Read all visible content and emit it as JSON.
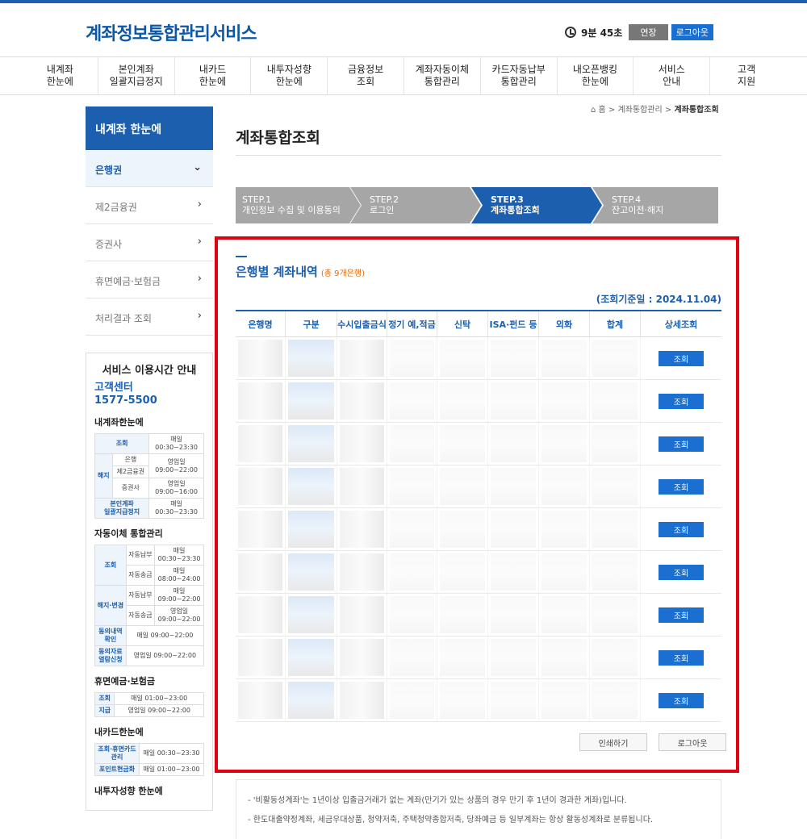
{
  "header": {
    "logo": "계좌정보통합관리서비스",
    "timer": "9분 45초",
    "extend": "연장",
    "logout": "로그아웃"
  },
  "gnb": [
    "내계좌\n한눈에",
    "본인계좌\n일괄지급정지",
    "내카드\n한눈에",
    "내투자성향\n한눈에",
    "금융정보\n조회",
    "계좌자동이체\n통합관리",
    "카드자동납부\n통합관리",
    "내오픈뱅킹\n한눈에",
    "서비스\n안내",
    "고객\n지원"
  ],
  "breadcrumb": {
    "home": "홈",
    "mid": "계좌통합관리",
    "current": "계좌통합조회"
  },
  "lnb": {
    "title": "내계좌 한눈에",
    "items": [
      "은행권",
      "제2금융권",
      "증권사",
      "휴면예금·보험금",
      "처리결과 조회"
    ]
  },
  "service": {
    "title": "서비스 이용시간 안내",
    "cc_label": "고객센터",
    "cc_phone": "1577-5500",
    "s1": "내계좌한눈에",
    "s1_rows": [
      [
        "조회",
        "",
        "매일\n00:30~23:30"
      ],
      [
        "",
        "은행",
        ""
      ],
      [
        "해지",
        "제2금융권",
        "영업일\n09:00~22:00"
      ],
      [
        "",
        "증권사",
        "영업일\n09:00~16:00"
      ],
      [
        "본인계좌\n일괄지급정지",
        "",
        "매일\n00:30~23:30"
      ]
    ],
    "s2": "자동이체 통합관리",
    "s2_rows": [
      [
        "조회",
        "자동납부",
        "매일\n00:30~23:30"
      ],
      [
        "",
        "자동송금",
        "매일\n08:00~24:00"
      ],
      [
        "해지·변경",
        "자동납부",
        "매일\n09:00~22:00"
      ],
      [
        "",
        "자동송금",
        "영업일\n09:00~22:00"
      ],
      [
        "동의내역\n확인",
        "",
        "매일 09:00~22:00"
      ],
      [
        "동의자료\n열람신청",
        "",
        "영업일 09:00~22:00"
      ]
    ],
    "s3": "휴면예금·보험금",
    "s3_rows": [
      [
        "조회",
        "매일 01:00~23:00"
      ],
      [
        "지급",
        "영업일 09:00~22:00"
      ]
    ],
    "s4": "내카드한눈에",
    "s4_rows": [
      [
        "조회·휴면카드\n관리",
        "매일 00:30~23:30"
      ],
      [
        "포인트현금화",
        "매일 01:00~23:00"
      ]
    ],
    "s5": "내투자성향 한눈에"
  },
  "page_title": "계좌통합조회",
  "steps": [
    {
      "n": "STEP.1",
      "t": "개인정보 수집 및 이용동의"
    },
    {
      "n": "STEP.2",
      "t": "로그인"
    },
    {
      "n": "STEP.3",
      "t": "계좌통합조회"
    },
    {
      "n": "STEP.4",
      "t": "잔고이전·해지"
    }
  ],
  "section": {
    "title": "은행별 계좌내역",
    "count": "(총 9개은행)",
    "ref_date": "(조회기준일 : 2024.11.04)"
  },
  "table": {
    "headers": [
      "은행명",
      "구분",
      "수시입출금식",
      "정기 예,적금",
      "신탁",
      "ISA·펀드 등",
      "외화",
      "합계",
      "상세조회"
    ],
    "row_button": "조회",
    "rows": 9
  },
  "buttons": {
    "print": "인쇄하기",
    "logout": "로그아웃"
  },
  "notes": [
    "- '비활동성계좌'는 1년이상 입출금거래가 없는 계좌(만기가 있는 상품의 경우 만기 후 1년이 경과한 계좌)입니다.",
    "- 한도대출약정계좌, 세금우대상품, 청약저축, 주택청약종합저축, 당좌예금 등 일부계좌는 항상 활동성계좌로 분류됩니다."
  ]
}
